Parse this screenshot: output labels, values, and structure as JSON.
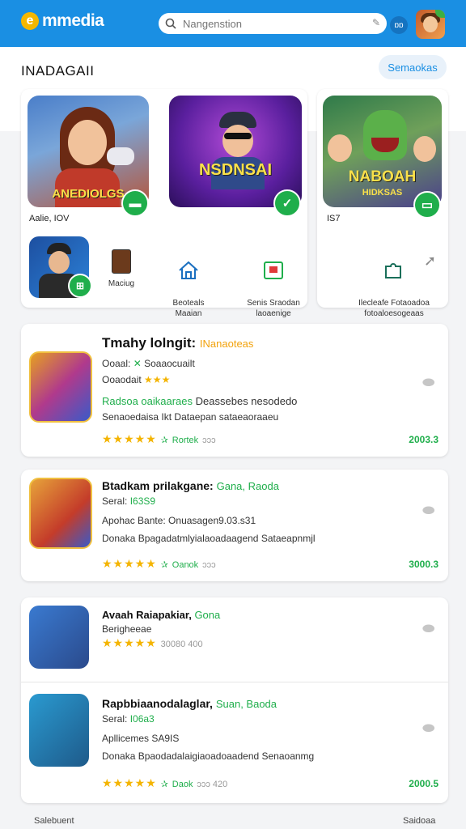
{
  "header": {
    "brand": "mmedia",
    "search_placeholder": "Nangenstion",
    "lang_label": "ɒɒ"
  },
  "section": {
    "title": "INADAGAII",
    "button": "Semaokas"
  },
  "featured": [
    {
      "title": "ANEDIOLGS",
      "caption": "Aalie, IOV"
    },
    {
      "title": "NSDNSAI",
      "caption": ""
    },
    {
      "title": "NABOAH",
      "subtitle": "HIDKSAS",
      "caption": "IS7"
    }
  ],
  "shortcuts": [
    {
      "label": "Maciug"
    },
    {
      "label": "Beoteals\nMaaian"
    },
    {
      "label": "Senis Sraodan\nlaoaenige"
    },
    {
      "label": "Ilecleafe Fotaoadoa\nfotoaloesogeaas"
    }
  ],
  "list": [
    {
      "title": "Tmahy lolngit:",
      "tag": "INanaoteas",
      "line1_a": "Ooaal:",
      "line1_b": "Soaaocuailt",
      "line2": "Ooaodait",
      "line3_green": "Radsoa oaikaaraes",
      "line3_rest": "Deassebes nesodedo",
      "line4": "Senaoedaisa Ikt Dataepan sataeaoraaeu",
      "rating_label": "Rortek",
      "rating_extra": "ɔɔɔ",
      "price": "2003.3"
    },
    {
      "title": "Btadkam prilakgane:",
      "tag": "Gana, Raoda",
      "line1_a": "Seral:",
      "line1_b": "I63S9",
      "line2": "Apohac Bante: Onuasagen9.03.s31",
      "line3": "Donaka Bpagadatmlyialaoadaagend Sataeapnmjl",
      "rating_label": "Oanok",
      "rating_extra": "ɔɔɔ",
      "price": "3000.3"
    },
    {
      "title": "Avaah Raiapakiar,",
      "tag": "Gona",
      "line1": "Berigheeae",
      "rating_extra": "30080 400",
      "price": ""
    },
    {
      "title": "Rapbbiaanodalaglar,",
      "tag": "Suan, Baoda",
      "line1_a": "Seral:",
      "line1_b": "I06a3",
      "line2": "Apllicemes SA9IS",
      "line3": "Donaka Bpaodadalaigiaoadoaadend Senaoanmg",
      "rating_label": "Daok",
      "rating_extra": "ɔɔɔ 420",
      "price": "2000.5"
    }
  ],
  "footer": {
    "left": "Salebuent",
    "right": "Saidoaa"
  },
  "colors": {
    "header": "#1a8fe3",
    "accent_green": "#1fae4b",
    "star": "#f4b400"
  }
}
